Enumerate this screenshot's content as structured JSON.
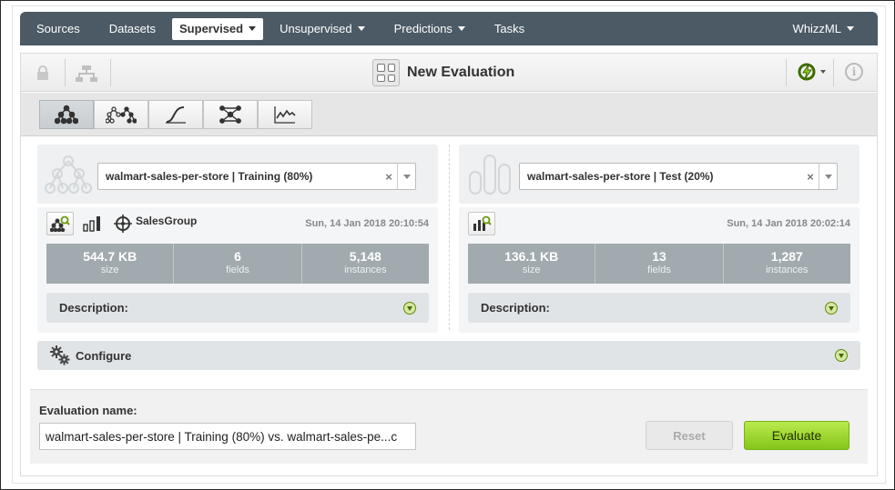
{
  "nav": {
    "items": [
      {
        "label": "Sources",
        "dropdown": false,
        "active": false
      },
      {
        "label": "Datasets",
        "dropdown": false,
        "active": false
      },
      {
        "label": "Supervised",
        "dropdown": true,
        "active": true
      },
      {
        "label": "Unsupervised",
        "dropdown": true,
        "active": false
      },
      {
        "label": "Predictions",
        "dropdown": true,
        "active": false
      },
      {
        "label": "Tasks",
        "dropdown": false,
        "active": false
      }
    ],
    "right_label": "WhizzML"
  },
  "toolbar": {
    "title": "New Evaluation",
    "icons": [
      "lock-icon",
      "tree-icon",
      "evaluation-icon",
      "sync-icon",
      "info-icon"
    ]
  },
  "tabs": [
    {
      "name": "model",
      "icon": "model-tree-icon",
      "active": true
    },
    {
      "name": "ensemble",
      "icon": "ensemble-icon",
      "active": false
    },
    {
      "name": "logistic-regression",
      "icon": "logistic-curve-icon",
      "active": false
    },
    {
      "name": "deepnet",
      "icon": "deepnet-icon",
      "active": false
    },
    {
      "name": "timeseries",
      "icon": "timeseries-icon",
      "active": false
    }
  ],
  "left": {
    "select_value": "walmart-sales-per-store | Training (80%)",
    "object_name": "SalesGroup",
    "date": "Sun, 14 Jan 2018 20:10:54",
    "stats": [
      {
        "value": "544.7 KB",
        "label": "size"
      },
      {
        "value": "6",
        "label": "fields"
      },
      {
        "value": "5,148",
        "label": "instances"
      }
    ],
    "description_label": "Description:"
  },
  "right": {
    "select_value": "walmart-sales-per-store | Test (20%)",
    "date": "Sun, 14 Jan 2018 20:02:14",
    "stats": [
      {
        "value": "136.1 KB",
        "label": "size"
      },
      {
        "value": "13",
        "label": "fields"
      },
      {
        "value": "1,287",
        "label": "instances"
      }
    ],
    "description_label": "Description:"
  },
  "configure_label": "Configure",
  "evaluation": {
    "name_label": "Evaluation name:",
    "name_value": "walmart-sales-per-store | Training (80%) vs. walmart-sales-pe...c",
    "reset_label": "Reset",
    "evaluate_label": "Evaluate"
  },
  "colors": {
    "nav_bg": "#4b5a64",
    "stats_bg": "#a1aaae",
    "evaluate_green": "#86c51a",
    "accent_green": "#5f8a10"
  }
}
